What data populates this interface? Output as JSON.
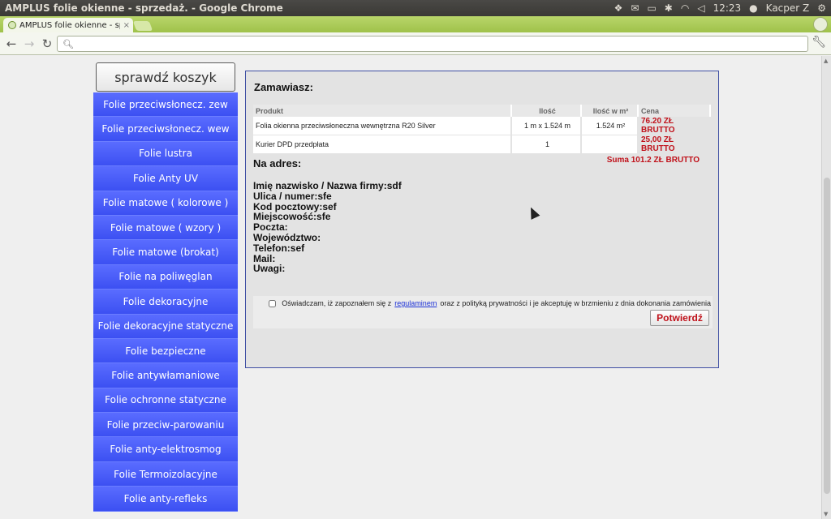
{
  "window": {
    "title": "AMPLUS folie okienne - sprzedaż. - Google Chrome",
    "clock": "12:23",
    "user": "Kacper Z"
  },
  "browser": {
    "tab_label": "AMPLUS folie okienne - sp",
    "tab_close": "×",
    "address_placeholder": ""
  },
  "sidebar": {
    "cart_button": "sprawdź koszyk",
    "items": [
      "Folie przeciwsłonecz. zew",
      "Folie przeciwsłonecz. wew",
      "Folie lustra",
      "Folie Anty UV",
      "Folie matowe ( kolorowe )",
      "Folie matowe ( wzory )",
      "Folie matowe (brokat)",
      "Folie na poliwęglan",
      "Folie dekoracyjne",
      "Folie dekoracyjne statyczne",
      "Folie bezpieczne",
      "Folie antywłamaniowe",
      "Folie ochronne statyczne",
      "Folie przeciw-parowaniu",
      "Folie anty-elektrosmog",
      "Folie Termoizolacyjne",
      "Folie anty-refleks"
    ]
  },
  "order": {
    "title": "Zamawiasz:",
    "headers": {
      "product": "Produkt",
      "qty": "Ilość",
      "qty_m2": "Ilość w m²",
      "price": "Cena"
    },
    "rows": [
      {
        "product": "Folia okienna przeciwsłoneczna wewnętrzna R20 Silver",
        "qty": "1 m x 1.524 m",
        "qty_m2": "1.524 m²",
        "price": "76.20 ZŁ BRUTTO"
      },
      {
        "product": "Kurier DPD przedpłata",
        "qty": "1",
        "qty_m2": "",
        "price": "25,00 ZŁ BRUTTO"
      }
    ],
    "sum": "Suma 101.2 ZŁ BRUTTO"
  },
  "address": {
    "title": "Na adres:",
    "lines": [
      "Imię nazwisko / Nazwa firmy:sdf",
      "Ulica / numer:sfe",
      "Kod pocztowy:sef",
      "Miejscowość:sfe",
      "Poczta:",
      "Województwo:",
      "Telefon:sef",
      "Mail:",
      "Uwagi:"
    ]
  },
  "confirm": {
    "terms_before": "Oświadczam, iż zapoznałem się z",
    "terms_link": "regulaminem",
    "terms_after": "oraz z polityką prywatności i je akceptuję w brzmieniu z dnia dokonania zamówienia",
    "button": "Potwierdź"
  },
  "colors": {
    "sidebar_blue": "#3c50f2",
    "price_red": "#c0111a",
    "chrome_green": "#9fc24a"
  }
}
